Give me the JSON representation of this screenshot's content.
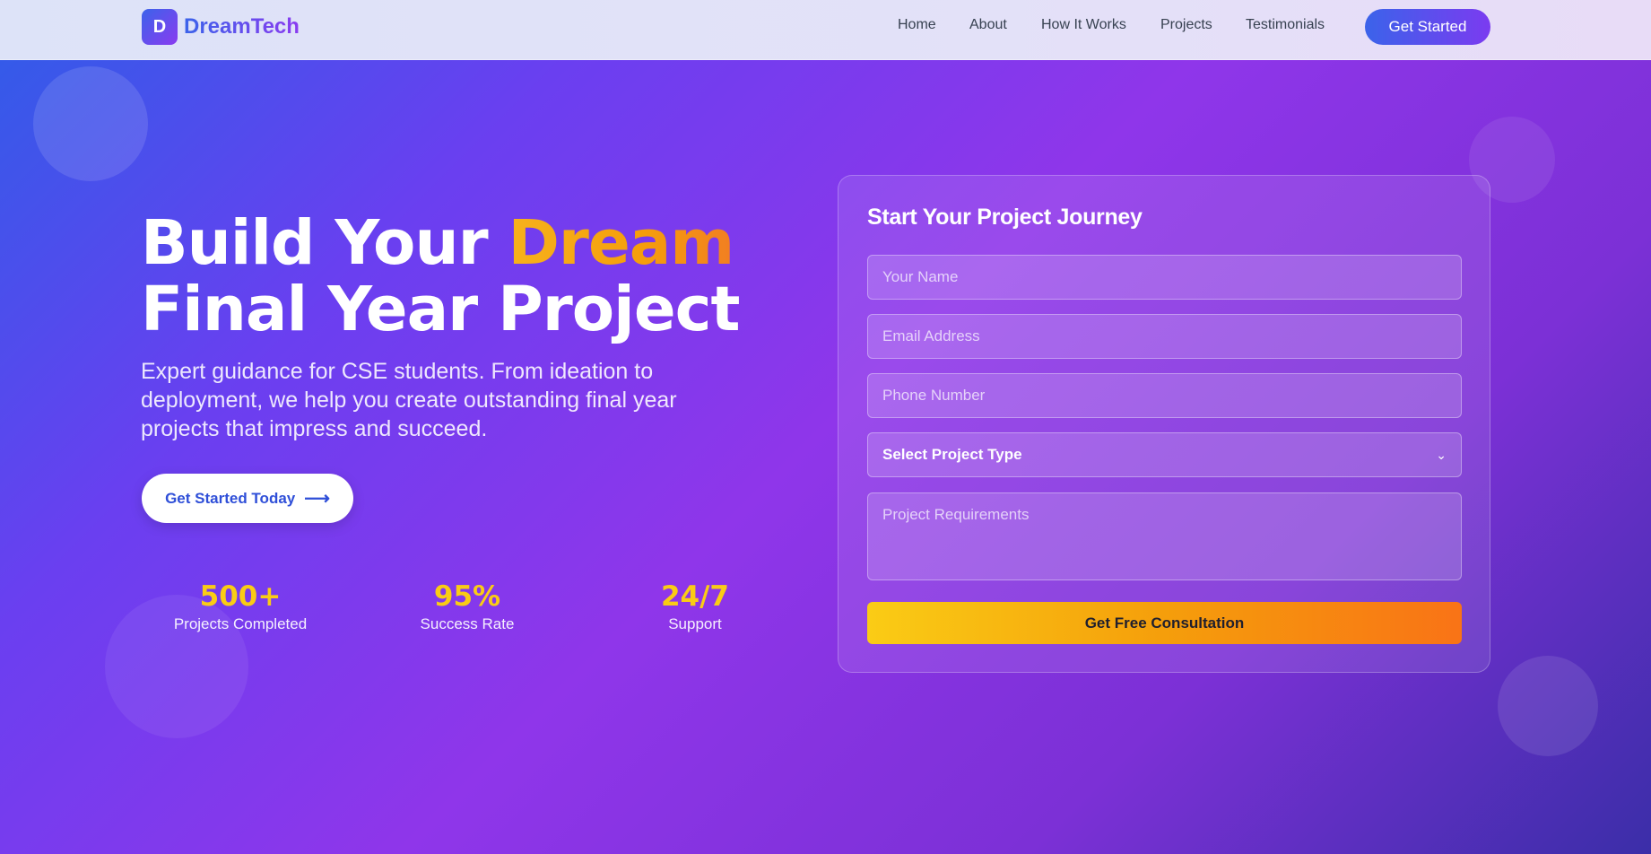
{
  "brand": {
    "logo_letter": "D",
    "name": "DreamTech"
  },
  "nav": {
    "links": [
      "Home",
      "About",
      "How It Works",
      "Projects",
      "Testimonials"
    ],
    "cta": "Get Started"
  },
  "hero": {
    "title_line1_prefix": "Build Your ",
    "title_line1_accent": "Dream",
    "title_line2": "Final Year Project",
    "subtitle": "Expert guidance for CSE students. From ideation to deployment, we help you create outstanding final year projects that impress and succeed.",
    "cta": "Get Started Today",
    "cta_icon": "arrow-right-icon"
  },
  "stats": [
    {
      "value": "500+",
      "label": "Projects Completed"
    },
    {
      "value": "95%",
      "label": "Success Rate"
    },
    {
      "value": "24/7",
      "label": "Support"
    }
  ],
  "form": {
    "title": "Start Your Project Journey",
    "name_placeholder": "Your Name",
    "email_placeholder": "Email Address",
    "phone_placeholder": "Phone Number",
    "project_type_selected": "Select Project Type",
    "requirements_placeholder": "Project Requirements",
    "submit": "Get Free Consultation"
  },
  "colors": {
    "accent_yellow": "#facc15",
    "brand_blue": "#3b63ea",
    "brand_purple": "#8a3bf0"
  }
}
